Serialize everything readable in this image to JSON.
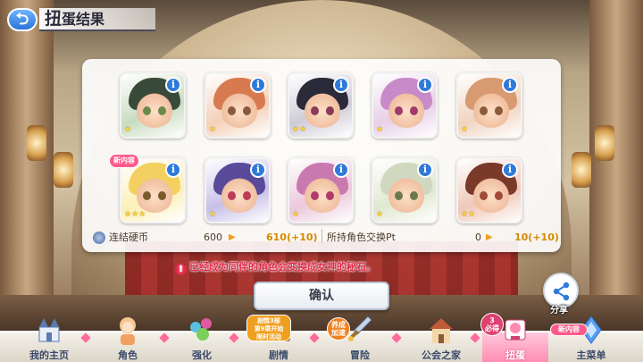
{
  "header": {
    "title": "扭蛋结果",
    "title_first": "扭",
    "title_rest": "蛋结果"
  },
  "cards": [
    {
      "hair": "#3a4a3a",
      "eye": "#6a8a4a",
      "bg": "#c8dcc0",
      "stars": "★"
    },
    {
      "hair": "#d87a50",
      "eye": "#8a5a3a",
      "bg": "#f4d0b8",
      "stars": "★"
    },
    {
      "hair": "#2a2a3a",
      "eye": "#8a3a5a",
      "bg": "#d0ccd8",
      "stars": "★★"
    },
    {
      "hair": "#c88ac8",
      "eye": "#a03a6a",
      "bg": "#e8d0e8",
      "stars": "★"
    },
    {
      "hair": "#d89a70",
      "eye": "#8a5a3a",
      "bg": "#f0d4c0",
      "stars": "★"
    },
    {
      "hair": "#f4d060",
      "eye": "#7a5a2a",
      "bg": "#fbf0b8",
      "stars": "★★★"
    },
    {
      "hair": "#5a4a9a",
      "eye": "#c03a5a",
      "bg": "#c8c0e8",
      "stars": "★"
    },
    {
      "hair": "#c87ab0",
      "eye": "#b03a6a",
      "bg": "#ecc8dc",
      "stars": "★"
    },
    {
      "hair": "#d0d8c0",
      "eye": "#6a7a4a",
      "bg": "#e0e8d0",
      "stars": "★"
    },
    {
      "hair": "#7a3a2a",
      "eye": "#a04a3a",
      "bg": "#f0c8b8",
      "stars": "★★"
    }
  ],
  "new_badge": "新内容",
  "currency": {
    "coin_label": "连结硬币",
    "coin_value": "600",
    "coin_after": "610(+10)",
    "pt_label": "所持角色交换Pt",
    "pt_value": "0",
    "pt_after": "10(+10)"
  },
  "notice": "已经成为同伴的角色会变换成女神的秘石。",
  "confirm_label": "确认",
  "share_label": "分享",
  "nav": [
    {
      "label": "我的主页",
      "icon": "home-castle-icon"
    },
    {
      "label": "角色",
      "icon": "character-icon"
    },
    {
      "label": "强化",
      "icon": "enhance-icon"
    },
    {
      "label": "剧情",
      "icon": "story-icon"
    },
    {
      "label": "冒险",
      "icon": "sword-icon"
    },
    {
      "label": "公会之家",
      "icon": "guild-house-icon"
    },
    {
      "label": "扭蛋",
      "icon": "gacha-icon"
    },
    {
      "label": "主菜单",
      "icon": "main-menu-icon"
    }
  ],
  "promos": {
    "story": "剧情3部\n第9章开始\n限时活动",
    "adventure": "养成\n加速",
    "gacha": "3\n必得",
    "menu": "新内容"
  },
  "colors": {
    "accent_blue": "#2f7ad9",
    "notice_red": "#e02a4a",
    "active_tab": "#ff8ab0"
  }
}
